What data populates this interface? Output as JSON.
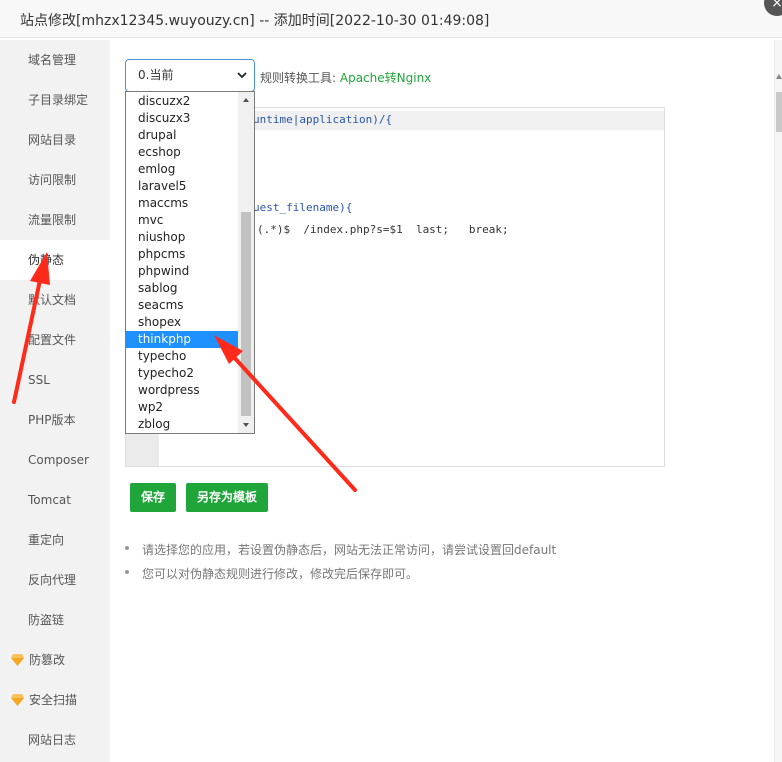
{
  "window": {
    "title": "站点修改[mhzx12345.wuyouzy.cn] -- 添加时间[2022-10-30 01:49:08]",
    "close_glyph": "×"
  },
  "sidebar": {
    "items": [
      {
        "label": "域名管理"
      },
      {
        "label": "子目录绑定"
      },
      {
        "label": "网站目录"
      },
      {
        "label": "访问限制"
      },
      {
        "label": "流量限制"
      },
      {
        "label": "伪静态",
        "active": true
      },
      {
        "label": "默认文档"
      },
      {
        "label": "配置文件"
      },
      {
        "label": "SSL"
      },
      {
        "label": "PHP版本"
      },
      {
        "label": "Composer"
      },
      {
        "label": "Tomcat"
      },
      {
        "label": "重定向"
      },
      {
        "label": "反向代理"
      },
      {
        "label": "防盗链"
      },
      {
        "label": "防篡改",
        "icon": "diamond-icon"
      },
      {
        "label": "安全扫描",
        "icon": "diamond-icon"
      },
      {
        "label": "网站日志"
      }
    ]
  },
  "rewrite": {
    "select_value": "0.当前",
    "tool_label": "规则转换工具:",
    "tool_link": "Apache转Nginx",
    "options": [
      "discuzx2",
      "discuzx3",
      "drupal",
      "ecshop",
      "emlog",
      "laravel5",
      "maccms",
      "mvc",
      "niushop",
      "phpcms",
      "phpwind",
      "sablog",
      "seacms",
      "shopex",
      "thinkphp",
      "typecho",
      "typecho2",
      "wordpress",
      "wp2",
      "zblog"
    ],
    "selected_option": "thinkphp",
    "code_lines": {
      "line1": "untime|application)/{",
      "line2": "uest_filename){",
      "line3": "(.*)$  /index.php?s=$1  last;   break;"
    }
  },
  "buttons": {
    "save": "保存",
    "save_template": "另存为模板"
  },
  "tips": [
    "请选择您的应用，若设置伪静态后，网站无法正常访问，请尝试设置回default",
    "您可以对伪静态规则进行修改，修改完后保存即可。"
  ],
  "colors": {
    "accent_green": "#20a53a",
    "selection_blue": "#1e90ff",
    "annotation_red": "#ff2a1a",
    "gem_gold": "#f5a623"
  }
}
